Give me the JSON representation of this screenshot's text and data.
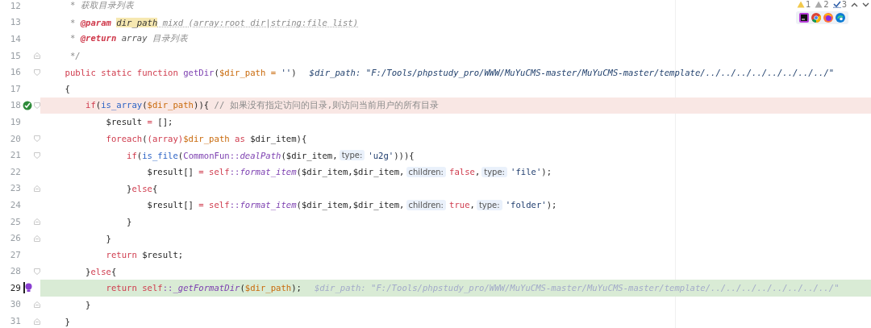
{
  "inspections": [
    {
      "kind": "warning",
      "count": "1"
    },
    {
      "kind": "weak_warning",
      "count": "2"
    },
    {
      "kind": "typo",
      "count": "3"
    }
  ],
  "lines": [
    {
      "number": "12",
      "breakpoint": false,
      "execution": false,
      "caret": false,
      "fold_start": false,
      "fold_end": false,
      "segments": [
        {
          "kind": "code",
          "tokens": [
            {
              "kind": "doc",
              "text": "     * 获取目录列表"
            }
          ]
        }
      ]
    },
    {
      "number": "13",
      "breakpoint": false,
      "execution": false,
      "caret": false,
      "fold_start": false,
      "fold_end": false,
      "segments": [
        {
          "kind": "code",
          "tokens": [
            {
              "kind": "doc",
              "text": "     * "
            },
            {
              "kind": "doctag",
              "text": "@param "
            },
            {
              "kind": "docref",
              "text": "dir_path"
            },
            {
              "kind": "doctypo",
              "text": " mixd (array:root dir|string:file list)"
            }
          ]
        }
      ]
    },
    {
      "number": "14",
      "breakpoint": false,
      "execution": false,
      "caret": false,
      "fold_start": false,
      "fold_end": false,
      "segments": [
        {
          "kind": "code",
          "tokens": [
            {
              "kind": "doc",
              "text": "     * "
            },
            {
              "kind": "doctag",
              "text": "@return"
            },
            {
              "kind": "doctype",
              "text": " array"
            },
            {
              "kind": "doc",
              "text": " 目录列表"
            }
          ]
        }
      ]
    },
    {
      "number": "15",
      "breakpoint": false,
      "execution": false,
      "caret": false,
      "fold_start": false,
      "fold_end": true,
      "segments": [
        {
          "kind": "code",
          "tokens": [
            {
              "kind": "doc",
              "text": "     */"
            }
          ]
        }
      ]
    },
    {
      "number": "16",
      "breakpoint": false,
      "execution": false,
      "caret": false,
      "fold_start": true,
      "fold_end": false,
      "segments": [
        {
          "kind": "code",
          "tokens": [
            {
              "kind": "kw",
              "text": "    public static function "
            },
            {
              "kind": "fn",
              "text": "getDir"
            },
            {
              "kind": "plain",
              "text": "("
            },
            {
              "kind": "param",
              "text": "$dir_path = "
            },
            {
              "kind": "str",
              "text": "''"
            },
            {
              "kind": "plain",
              "text": ")"
            }
          ]
        },
        {
          "kind": "inline_value",
          "text": "$dir_path: \"F:/Tools/phpstudy_pro/WWW/MuYuCMS-master/MuYuCMS-master/template/../../../../../../../../\""
        }
      ]
    },
    {
      "number": "17",
      "breakpoint": false,
      "execution": false,
      "caret": false,
      "fold_start": false,
      "fold_end": false,
      "segments": [
        {
          "kind": "code",
          "tokens": [
            {
              "kind": "plain",
              "text": "    {"
            }
          ]
        }
      ]
    },
    {
      "number": "18",
      "breakpoint": true,
      "execution": false,
      "caret": false,
      "fold_start": true,
      "fold_end": false,
      "segments": [
        {
          "kind": "code",
          "tokens": [
            {
              "kind": "kw",
              "text": "        if"
            },
            {
              "kind": "plain",
              "text": "("
            },
            {
              "kind": "builtin",
              "text": "is_array"
            },
            {
              "kind": "plain",
              "text": "("
            },
            {
              "kind": "param",
              "text": "$dir_path"
            },
            {
              "kind": "plain",
              "text": ")){ "
            },
            {
              "kind": "comment",
              "text": "// 如果没有指定访问的目录,则访问当前用户的所有目录"
            }
          ]
        }
      ]
    },
    {
      "number": "19",
      "breakpoint": false,
      "execution": false,
      "caret": false,
      "fold_start": false,
      "fold_end": false,
      "segments": [
        {
          "kind": "code",
          "tokens": [
            {
              "kind": "plain",
              "text": "            $result "
            },
            {
              "kind": "op",
              "text": "="
            },
            {
              "kind": "plain",
              "text": " [];"
            }
          ]
        }
      ]
    },
    {
      "number": "20",
      "breakpoint": false,
      "execution": false,
      "caret": false,
      "fold_start": true,
      "fold_end": false,
      "segments": [
        {
          "kind": "code",
          "tokens": [
            {
              "kind": "kw",
              "text": "            foreach"
            },
            {
              "kind": "plain",
              "text": "("
            },
            {
              "kind": "kw",
              "text": "(array)"
            },
            {
              "kind": "param",
              "text": "$dir_path"
            },
            {
              "kind": "kw",
              "text": " as"
            },
            {
              "kind": "plain",
              "text": " $dir_item){"
            }
          ]
        }
      ]
    },
    {
      "number": "21",
      "breakpoint": false,
      "execution": false,
      "caret": false,
      "fold_start": true,
      "fold_end": false,
      "segments": [
        {
          "kind": "code",
          "tokens": [
            {
              "kind": "kw",
              "text": "                if"
            },
            {
              "kind": "plain",
              "text": "("
            },
            {
              "kind": "builtin",
              "text": "is_file"
            },
            {
              "kind": "plain",
              "text": "("
            },
            {
              "kind": "cls",
              "text": "CommonFun::"
            },
            {
              "kind": "static",
              "text": "dealPath"
            },
            {
              "kind": "plain",
              "text": "($dir_item,"
            }
          ]
        },
        {
          "kind": "hint",
          "text": "type:"
        },
        {
          "kind": "code",
          "tokens": [
            {
              "kind": "str",
              "text": "'u2g'"
            },
            {
              "kind": "plain",
              "text": "))){"
            }
          ]
        }
      ]
    },
    {
      "number": "22",
      "breakpoint": false,
      "execution": false,
      "caret": false,
      "fold_start": false,
      "fold_end": false,
      "segments": [
        {
          "kind": "code",
          "tokens": [
            {
              "kind": "plain",
              "text": "                    $result[] "
            },
            {
              "kind": "op",
              "text": "="
            },
            {
              "kind": "kw",
              "text": " self"
            },
            {
              "kind": "cls",
              "text": "::"
            },
            {
              "kind": "static",
              "text": "format_item"
            },
            {
              "kind": "plain",
              "text": "($dir_item,$dir_item,"
            }
          ]
        },
        {
          "kind": "hint",
          "text": "children:"
        },
        {
          "kind": "code",
          "tokens": [
            {
              "kind": "kw",
              "text": "false"
            },
            {
              "kind": "plain",
              "text": ","
            }
          ]
        },
        {
          "kind": "hint",
          "text": "type:"
        },
        {
          "kind": "code",
          "tokens": [
            {
              "kind": "str",
              "text": "'file'"
            },
            {
              "kind": "plain",
              "text": ");"
            }
          ]
        }
      ]
    },
    {
      "number": "23",
      "breakpoint": false,
      "execution": false,
      "caret": false,
      "fold_start": false,
      "fold_end": true,
      "segments": [
        {
          "kind": "code",
          "tokens": [
            {
              "kind": "plain",
              "text": "                }"
            },
            {
              "kind": "kw",
              "text": "else"
            },
            {
              "kind": "plain",
              "text": "{"
            }
          ]
        }
      ]
    },
    {
      "number": "24",
      "breakpoint": false,
      "execution": false,
      "caret": false,
      "fold_start": false,
      "fold_end": false,
      "segments": [
        {
          "kind": "code",
          "tokens": [
            {
              "kind": "plain",
              "text": "                    $result[] "
            },
            {
              "kind": "op",
              "text": "="
            },
            {
              "kind": "kw",
              "text": " self"
            },
            {
              "kind": "cls",
              "text": "::"
            },
            {
              "kind": "static",
              "text": "format_item"
            },
            {
              "kind": "plain",
              "text": "($dir_item,$dir_item,"
            }
          ]
        },
        {
          "kind": "hint",
          "text": "children:"
        },
        {
          "kind": "code",
          "tokens": [
            {
              "kind": "kw",
              "text": "true"
            },
            {
              "kind": "plain",
              "text": ","
            }
          ]
        },
        {
          "kind": "hint",
          "text": "type:"
        },
        {
          "kind": "code",
          "tokens": [
            {
              "kind": "str",
              "text": "'folder'"
            },
            {
              "kind": "plain",
              "text": ");"
            }
          ]
        }
      ]
    },
    {
      "number": "25",
      "breakpoint": false,
      "execution": false,
      "caret": false,
      "fold_start": false,
      "fold_end": true,
      "segments": [
        {
          "kind": "code",
          "tokens": [
            {
              "kind": "plain",
              "text": "                }"
            }
          ]
        }
      ]
    },
    {
      "number": "26",
      "breakpoint": false,
      "execution": false,
      "caret": false,
      "fold_start": false,
      "fold_end": true,
      "segments": [
        {
          "kind": "code",
          "tokens": [
            {
              "kind": "plain",
              "text": "            }"
            }
          ]
        }
      ]
    },
    {
      "number": "27",
      "breakpoint": false,
      "execution": false,
      "caret": false,
      "fold_start": false,
      "fold_end": false,
      "segments": [
        {
          "kind": "code",
          "tokens": [
            {
              "kind": "kw",
              "text": "            return"
            },
            {
              "kind": "plain",
              "text": " $result;"
            }
          ]
        }
      ]
    },
    {
      "number": "28",
      "breakpoint": false,
      "execution": false,
      "caret": false,
      "fold_start": true,
      "fold_end": false,
      "segments": [
        {
          "kind": "code",
          "tokens": [
            {
              "kind": "plain",
              "text": "        }"
            },
            {
              "kind": "kw",
              "text": "else"
            },
            {
              "kind": "plain",
              "text": "{"
            }
          ]
        }
      ]
    },
    {
      "number": "29",
      "breakpoint": false,
      "execution": true,
      "caret": true,
      "fold_start": false,
      "fold_end": false,
      "segments": [
        {
          "kind": "code",
          "tokens": [
            {
              "kind": "kw",
              "text": "            return self"
            },
            {
              "kind": "cls",
              "text": "::"
            },
            {
              "kind": "static",
              "text": "_getFormatDir"
            },
            {
              "kind": "plain",
              "text": "("
            },
            {
              "kind": "param",
              "text": "$dir_path"
            },
            {
              "kind": "plain",
              "text": ");"
            }
          ]
        },
        {
          "kind": "inline_value",
          "text": "$dir_path: \"F:/Tools/phpstudy_pro/WWW/MuYuCMS-master/MuYuCMS-master/template/../../../../../../../../\""
        }
      ]
    },
    {
      "number": "30",
      "breakpoint": false,
      "execution": false,
      "caret": false,
      "fold_start": false,
      "fold_end": true,
      "segments": [
        {
          "kind": "code",
          "tokens": [
            {
              "kind": "plain",
              "text": "        }"
            }
          ]
        }
      ]
    },
    {
      "number": "31",
      "breakpoint": false,
      "execution": false,
      "caret": false,
      "fold_start": false,
      "fold_end": true,
      "segments": [
        {
          "kind": "code",
          "tokens": [
            {
              "kind": "plain",
              "text": "    }"
            }
          ]
        }
      ]
    }
  ]
}
